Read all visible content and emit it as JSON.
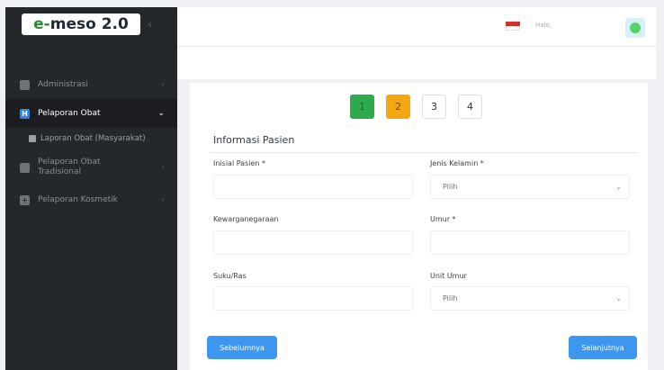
{
  "app": {
    "logo_text": "e-meso 2.0",
    "collapse_icon": "chevron-left-icon"
  },
  "sidebar": {
    "items": [
      {
        "label": "Administrasi",
        "icon": "folder-icon"
      },
      {
        "label": "Pelaporan Obat",
        "icon": "h-box-icon"
      },
      {
        "label": "Laporan Obat (Masyarakat)",
        "icon": "document-icon"
      },
      {
        "label": "Pelaporan Obat Tradisional",
        "icon": "briefcase-icon"
      },
      {
        "label": "Pelaporan Kosmetik",
        "icon": "plus-box-icon"
      }
    ]
  },
  "topbar": {
    "greeting": "Halo,"
  },
  "steps": [
    "1",
    "2",
    "3",
    "4"
  ],
  "form": {
    "section_title": "Informasi Pasien",
    "fields": {
      "inisial_label": "Inisial Pasien *",
      "jenis_kelamin_label": "Jenis Kelamin *",
      "jenis_kelamin_value": "Pilih",
      "kewarganegaraan_label": "Kewarganegaraan",
      "umur_label": "Umur *",
      "suku_label": "Suku/Ras",
      "unit_umur_label": "Unit Umur",
      "unit_umur_value": "Pilih"
    },
    "buttons": {
      "prev": "Sebelumnya",
      "next": "Selanjutnya"
    }
  },
  "colors": {
    "accent": "#3d97ef",
    "step_done": "#2ea94b",
    "step_current": "#f3a812",
    "sidebar_bg": "#24272b"
  }
}
